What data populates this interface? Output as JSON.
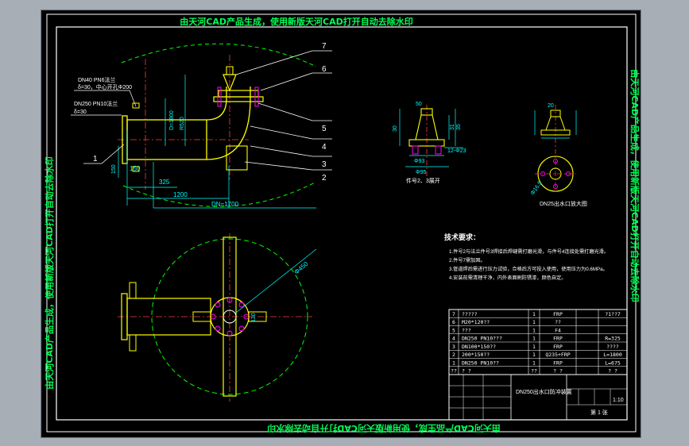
{
  "watermark": {
    "top": "由天河CAD产品生成，使用新版天河CAD打开自动去除水印",
    "bottom": "由天河CAD产品生成，使用新版天河CAD打开自动去除水印",
    "right": "由天河CAD产品生成，使用新版天河CAD打开自动去除水印",
    "left": "由天河CAD产品生成，使用新版天河CAD打开自动去除水印"
  },
  "callouts": [
    "1",
    "2",
    "3",
    "4",
    "5",
    "6",
    "7"
  ],
  "notes_left": {
    "n1a": "DN40 PN6法兰",
    "n1b": "δ=30，中心开孔Φ200",
    "n2a": "DN250 PN10法兰",
    "n2b": "δ=30"
  },
  "dimensions": {
    "d150a": "150",
    "d150b": "150",
    "d325": "325",
    "d1200": "1200",
    "d1700": "DN=1700",
    "d130": "130",
    "dR": "R520",
    "dD": "D=1800",
    "d450": "Φ450",
    "d12": "12-Φ23",
    "d95": "Φ95",
    "d93": "Φ93",
    "d30": "30",
    "d31": "31",
    "d35": "35",
    "d50": "50",
    "d20": "20"
  },
  "view_labels": {
    "tiny1": "件号2、3展开",
    "tiny2": "DN25出水口放大图",
    "tiny3": "Φ16.5"
  },
  "tech_title": "技术要求：",
  "tech_notes": [
    "1.件号2与法兰件号3焊接后焊缝需打磨光滑，与件号4连接处需打磨光滑。",
    "2.件号7需加固。",
    "3.管道焊后需进行压力试验，合格后方可投入使用，使用压力为0.6MPa。",
    "4.安装前需清理干净，内外表面刷防锈漆，颜色自定。"
  ],
  "bom": [
    {
      "no": "7",
      "name": "?????",
      "qty": "1",
      "mat": "FRP",
      "note": "?1??7"
    },
    {
      "no": "6",
      "name": "M20*120??",
      "qty": "1",
      "mat": "??",
      "note": ""
    },
    {
      "no": "5",
      "name": "???",
      "qty": "1",
      "mat": "F4",
      "note": ""
    },
    {
      "no": "4",
      "name": "DN250 PN10???",
      "qty": "1",
      "mat": "FRP",
      "note": "R=325"
    },
    {
      "no": "3",
      "name": "DN100*150??",
      "qty": "1",
      "mat": "FRP",
      "note": "????"
    },
    {
      "no": "2",
      "name": "200*150??",
      "qty": "1",
      "mat": "Q235+FRP",
      "note": "L=1800"
    },
    {
      "no": "1",
      "name": "DN250 PN10??",
      "qty": "1",
      "mat": "FRP",
      "note": "L=675"
    },
    {
      "no": "??",
      "name": "?     ?",
      "qty": "??",
      "mat": "?  ?",
      "note": "? ?"
    }
  ],
  "title_block": {
    "drawing_name": "DN250出水口防冲装置",
    "scale": "1:10",
    "sheet": "共1",
    "page": "第 1 张"
  }
}
